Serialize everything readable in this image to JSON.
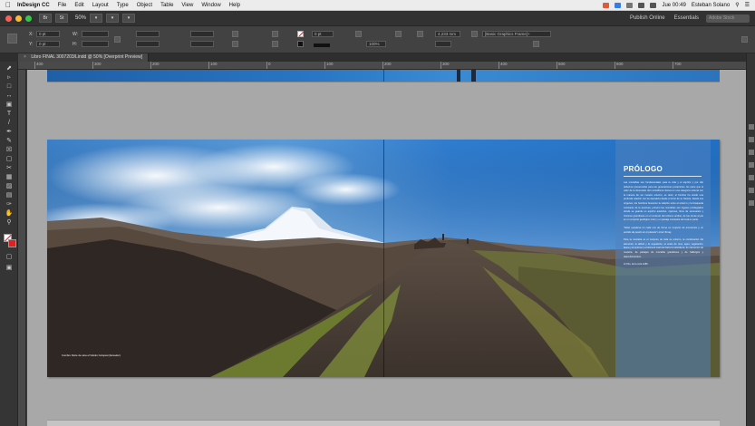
{
  "menubar": {
    "app_name": "InDesign CC",
    "items": [
      "File",
      "Edit",
      "Layout",
      "Type",
      "Object",
      "Table",
      "View",
      "Window",
      "Help"
    ],
    "clock": "Jue 00:49",
    "user": "Esteban Solano"
  },
  "appbar": {
    "zoom": "50%",
    "publish": "Publish Online",
    "workspace": "Essentials",
    "search_placeholder": "Adobe Stock"
  },
  "control": {
    "x_value": "0 pt",
    "y_value": "0 pt",
    "stroke_weight": "0 pt",
    "opacity": "100%",
    "gap_value": "4,233 mm",
    "style": "[Basic Graphics Frame]+"
  },
  "document": {
    "tab_title": "Libro FINAL 3007203/Lindd @ 50% [Overprint Preview]"
  },
  "ruler": {
    "marks": [
      "400",
      "300",
      "200",
      "100",
      "0",
      "100",
      "200",
      "300",
      "400",
      "500",
      "600",
      "700"
    ]
  },
  "spread": {
    "title": "PRÓLOGO",
    "paragraphs": [
      "Las montañas son fundamentales para la vida y el espíritu y por ello debemos preservarlas para las generaciones posteriores. Es parte que el valor de la dimensión del montañismo deriva en una categoría cultural con la manera de ver nuestro entorno, es decir, el hombre ha tenido una profunda relación con la naturaleza desde el inicio de su historia. Desde sus orígenes, los hombres buscaron la relación entre el entorno y la búsqueda constante de la aventura, primero las montañas son lugares privilegiados donde se guarda un espíritu auténtico, vigoroso, lleno de escenarios y rincones grandiosos en el contexto del entorno andino, de las cimas al pie en un conjunto geológico único y un paisaje constante del cual es parte.",
      "\"Debe quedarse en cada uno de forma un conjunto de emociones y un sentido de pasión en el planeta\" Lionel Terray.",
      "Para la montaña es el conjunto de toda su entorno, la combinación del elemento, la altitud y la vegetación, el suelo de roca, agua, vegetación, fauna y el entorno y el clima el cual nos hace la naturaleza, de elementos de muestra, de paisajes de montaña grandiosos y de hallazgos y descubrimientos.",
      "Al Vito, de la cota 1280."
    ],
    "caption": "Cumbre Norte de cara el Volcán Cotopaxi (Ecuador)."
  },
  "colors": {
    "sky": "#2a76c4",
    "panel": "#5082be",
    "pasteboard": "#a8a8a8",
    "chrome": "#424242"
  }
}
